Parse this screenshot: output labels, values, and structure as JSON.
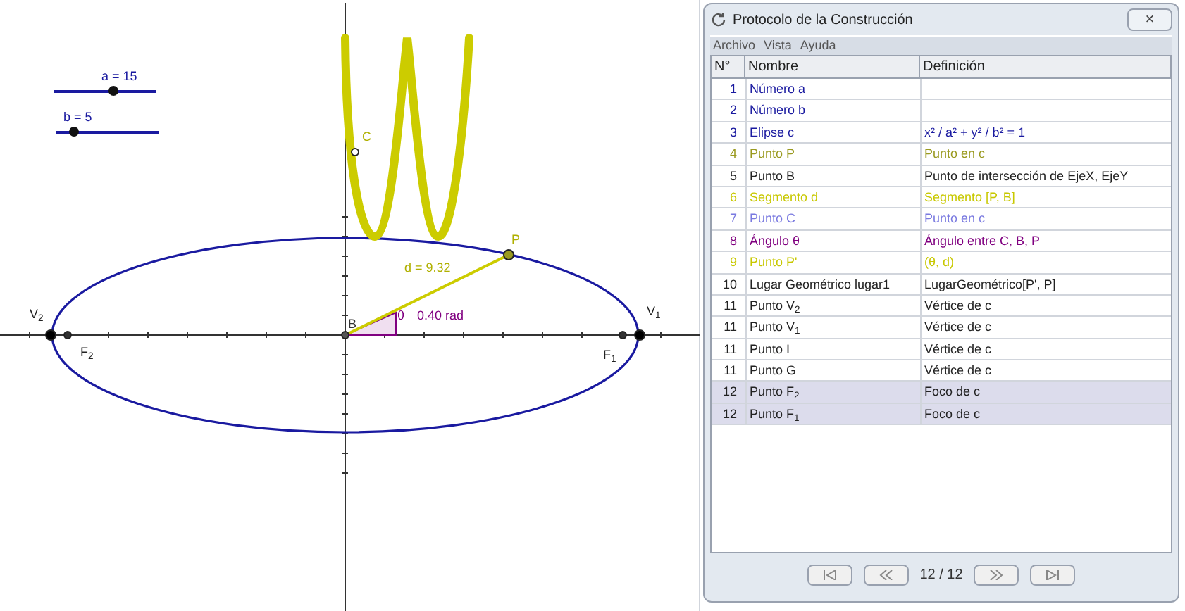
{
  "canvas": {
    "sliders": [
      {
        "label": "a = 15",
        "level": 0.58
      },
      {
        "label": "b = 5",
        "level": 0.16
      }
    ],
    "labels": [
      "C",
      "P",
      "d = 9.32",
      "V$_{2}$",
      "B",
      "θ",
      "0.40 rad",
      "V$_{1}$",
      "F$_{2}$",
      "F$_{1}$"
    ]
  },
  "dialog": {
    "title": "Protocolo de la Construcción",
    "close": "×",
    "menu": [
      "Archivo",
      "Vista",
      "Ayuda"
    ],
    "columns": [
      "N°",
      "Nombre",
      "Definición"
    ],
    "rows": [
      {
        "n": "1",
        "nombre": "Número a",
        "definicion": "",
        "color": "#1a1aa0",
        "selected": false
      },
      {
        "n": "2",
        "nombre": "Número b",
        "definicion": "",
        "color": "#1a1aa0",
        "selected": false
      },
      {
        "n": "3",
        "nombre": "Elipse c",
        "definicion": "x² / a² + y² / b² = 1",
        "color": "#1a1aa0",
        "selected": false
      },
      {
        "n": "4",
        "nombre": "Punto P",
        "definicion": "Punto en c",
        "color": "#9a9a20",
        "selected": false
      },
      {
        "n": "5",
        "nombre": "Punto B",
        "definicion": "Punto de intersección de EjeX, EjeY",
        "color": "#222222",
        "selected": false
      },
      {
        "n": "6",
        "nombre": "Segmento d",
        "definicion": "Segmento [P, B]",
        "color": "#c8c800",
        "selected": false
      },
      {
        "n": "7",
        "nombre": "Punto C",
        "definicion": "Punto en c",
        "color": "#7a7ae0",
        "selected": false
      },
      {
        "n": "8",
        "nombre": "Ángulo θ",
        "definicion": "Ángulo entre C, B, P",
        "color": "#800080",
        "selected": false
      },
      {
        "n": "9",
        "nombre": "Punto P'",
        "definicion": "(θ, d)",
        "color": "#c8c800",
        "selected": false
      },
      {
        "n": "10",
        "nombre": "Lugar Geométrico lugar1",
        "definicion": "LugarGeométrico[P', P]",
        "color": "#222222",
        "selected": false
      },
      {
        "n": "11",
        "nombre": "Punto V$_{2}$",
        "definicion": "Vértice de c",
        "color": "#222222",
        "selected": false
      },
      {
        "n": "11",
        "nombre": "Punto V$_{1}$",
        "definicion": "Vértice de c",
        "color": "#222222",
        "selected": false
      },
      {
        "n": "11",
        "nombre": "Punto I",
        "definicion": "Vértice de c",
        "color": "#222222",
        "selected": false
      },
      {
        "n": "11",
        "nombre": "Punto G",
        "definicion": "Vértice de c",
        "color": "#222222",
        "selected": false
      },
      {
        "n": "12",
        "nombre": "Punto F$_{2}$",
        "definicion": "Foco de c",
        "color": "#222222",
        "selected": true
      },
      {
        "n": "12",
        "nombre": "Punto F$_{1}$",
        "definicion": "Foco de c",
        "color": "#222222",
        "selected": true
      }
    ],
    "page": "12 / 12"
  }
}
